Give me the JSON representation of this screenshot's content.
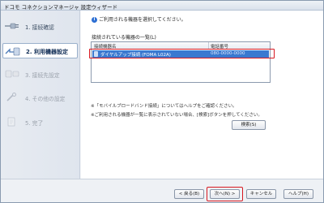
{
  "window": {
    "title": "ドコモ コネクションマネージャ 設定ウィザード"
  },
  "steps": [
    {
      "label": "1. 接続確認",
      "icon": "cable-icon"
    },
    {
      "label": "2. 利用機器設定",
      "icon": "device-arrow-icon"
    },
    {
      "label": "3. 接続先設定",
      "icon": "connection-icon"
    },
    {
      "label": "4. その他の設定",
      "icon": "wrench-icon"
    },
    {
      "label": "5. 完了",
      "icon": "document-icon"
    }
  ],
  "main": {
    "instruction": "ご利用される機器を選択してください。",
    "list_caption": "接続されている機器の一覧(L)",
    "columns": [
      "接続機器名",
      "電話番号"
    ],
    "rows": [
      {
        "name": "ダイヤルアップ接続 (FOMA L02A)",
        "phone": "080-0000-0000"
      }
    ],
    "notes": [
      "※「モバイルブロードバンド接続」についてはヘルプをご確認ください。",
      "※ご利用される機器が一覧に表示されていない場合、[検索]ボタンを押してください。"
    ],
    "search_button": "検索(S)"
  },
  "footer": {
    "back": "< 戻る(B)",
    "next": "次へ(N) >",
    "cancel": "キャンセル",
    "help": "ヘルプ(H)"
  },
  "colors": {
    "selection": "#3a79d0",
    "highlight_box": "#d71921"
  }
}
